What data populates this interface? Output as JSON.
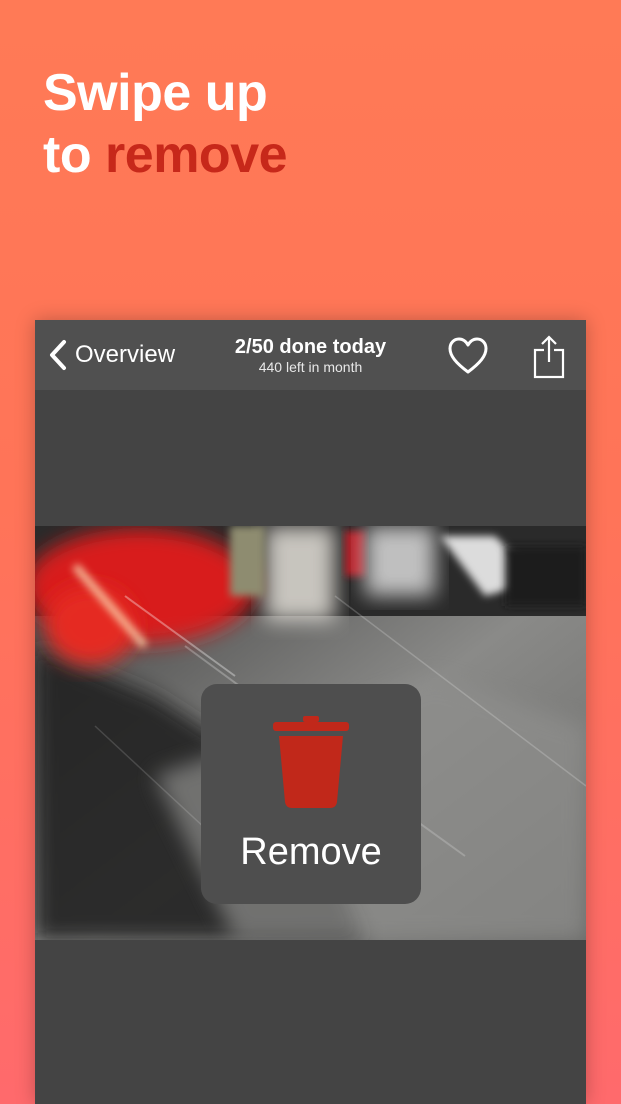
{
  "promo": {
    "line1": "Swipe up",
    "line2_prefix": "to ",
    "line2_accent": "remove",
    "accent_color": "#c7281a"
  },
  "navbar": {
    "back_label": "Overview",
    "back_icon": "chevron-left-icon",
    "progress_title": "2/50 done today",
    "progress_subtitle": "440 left in month",
    "favorite_icon": "heart-icon",
    "share_icon": "share-icon"
  },
  "overlay": {
    "label": "Remove",
    "icon": "trash-icon",
    "icon_color": "#c1281a"
  }
}
